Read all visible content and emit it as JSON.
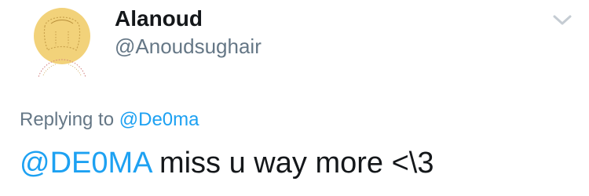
{
  "author": {
    "display_name": "Alanoud",
    "username": "@Anoudsughair",
    "avatar_icon": "illustrated-person-avatar"
  },
  "reply": {
    "prefix": "Replying to",
    "mention": "@De0ma"
  },
  "tweet": {
    "mention": "@DE0MA",
    "text": " miss u way more <\\3"
  },
  "icons": {
    "more": "chevron-down-icon"
  },
  "colors": {
    "link": "#1da1f2",
    "text_primary": "#14171a",
    "text_secondary": "#657786",
    "avatar_fill": "#f2d27a",
    "chevron": "#c5ccd3"
  }
}
